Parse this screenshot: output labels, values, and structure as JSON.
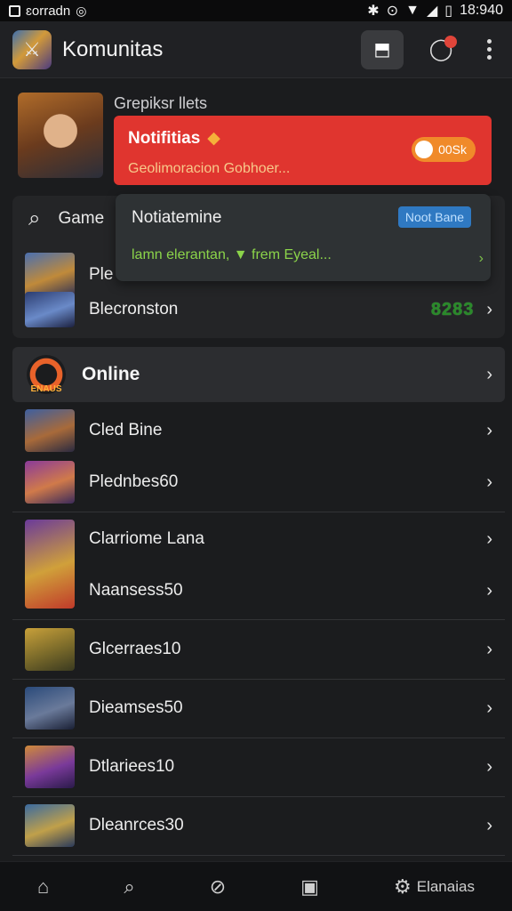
{
  "status_bar": {
    "carrier": "ɛorradn",
    "time": "18:940"
  },
  "app_bar": {
    "title": "Komunitas"
  },
  "profile": {
    "label": "Grepiksr llets"
  },
  "notification_red": {
    "title": "Notifitias",
    "subtitle": "Geolimoracion Gobhoer...",
    "badge": "00Sk"
  },
  "search": {
    "label": "Game"
  },
  "notification_dark": {
    "title": "Notiatemine",
    "tag": "Noot Bane",
    "body": "lamn elerantan, ▼ frem Eyeal..."
  },
  "top_list": [
    {
      "label": "Ple"
    },
    {
      "label": "Blecronston",
      "score": "8283"
    }
  ],
  "online": {
    "logo_text": "ENAUS",
    "label": "Online"
  },
  "list": [
    {
      "label": "Cled Bine"
    },
    {
      "label": "Plednbes60"
    },
    {
      "label": "Clarriome Lana"
    },
    {
      "label": "Naansess50"
    },
    {
      "label": "Glcerraes10"
    },
    {
      "label": "Dieamses50"
    },
    {
      "label": "Dtlariees10"
    },
    {
      "label": "Dleanrces30"
    }
  ],
  "bottom_nav": {
    "settings_label": "Elanaias"
  },
  "colors": {
    "accent_red": "#e0352f",
    "tag_blue": "#2f79c2",
    "green_text": "#8bd44a"
  }
}
